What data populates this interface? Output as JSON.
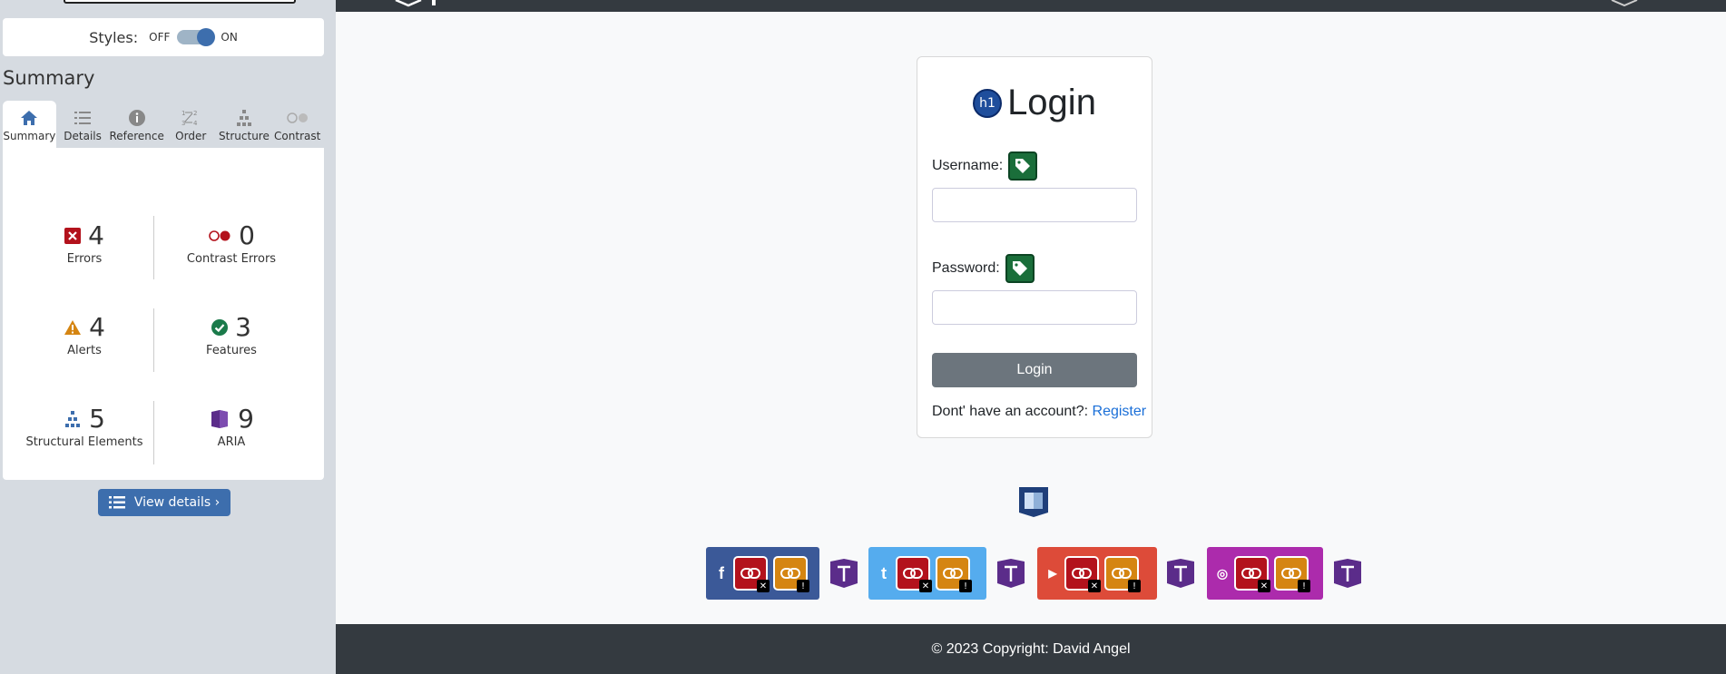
{
  "sidebar": {
    "styles": {
      "label": "Styles:",
      "off": "OFF",
      "on": "ON"
    },
    "summary_title": "Summary",
    "tabs": [
      {
        "label": "Summary",
        "icon": "home-icon"
      },
      {
        "label": "Details",
        "icon": "list-icon"
      },
      {
        "label": "Reference",
        "icon": "info-icon"
      },
      {
        "label": "Order",
        "icon": "order-icon"
      },
      {
        "label": "Structure",
        "icon": "structure-icon"
      },
      {
        "label": "Contrast",
        "icon": "contrast-icon"
      }
    ],
    "stats": {
      "errors": {
        "count": "4",
        "label": "Errors"
      },
      "contrast": {
        "count": "0",
        "label": "Contrast Errors"
      },
      "alerts": {
        "count": "4",
        "label": "Alerts"
      },
      "features": {
        "count": "3",
        "label": "Features"
      },
      "structural": {
        "count": "5",
        "label": "Structural Elements"
      },
      "aria": {
        "count": "9",
        "label": "ARIA"
      }
    },
    "view_details": "View details ›"
  },
  "page": {
    "card": {
      "h1_badge": "h1",
      "title": "Login",
      "username_label": "Username:",
      "password_label": "Password:",
      "login_button": "Login",
      "register_prompt": "Dont' have an account?:",
      "register_link": "Register"
    },
    "socials": [
      {
        "name": "facebook",
        "glyph": "f",
        "color": "#3b5998"
      },
      {
        "name": "twitter",
        "glyph": "t",
        "color": "#55acee"
      },
      {
        "name": "youtube",
        "glyph": "▶",
        "color": "#dd4b39"
      },
      {
        "name": "instagram",
        "glyph": "◎",
        "color": "#ac2bac"
      }
    ],
    "footer": "© 2023 Copyright: David Angel"
  },
  "colors": {
    "wave_blue": "#3d6ead",
    "error_red": "#b3121c",
    "alert_orange": "#d58512",
    "feature_green": "#1a6e3a",
    "aria_purple": "#5b2c8a",
    "navbar_dark": "#343a40"
  }
}
